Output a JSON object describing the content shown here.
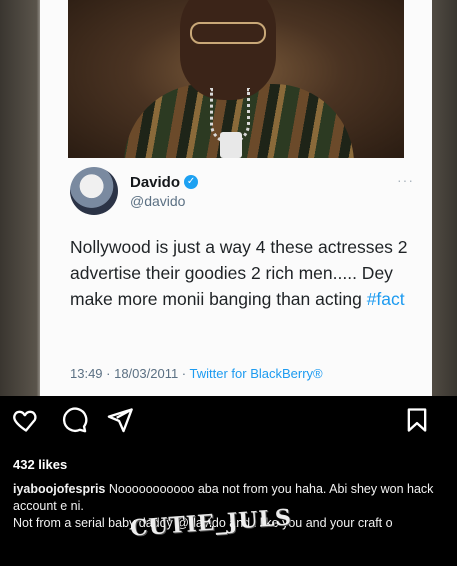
{
  "tweet": {
    "display_name": "Davido",
    "handle": "@davido",
    "text_main": "Nollywood is just a way 4 these actresses 2 advertise their goodies 2 rich men..... Dey make more monii banging than acting ",
    "hashtag": "#fact",
    "time": "13:49 · 18/03/2011 · ",
    "source": "Twitter for BlackBerry®",
    "more": "···"
  },
  "post": {
    "likes": "432 likes",
    "caption_user": "iyaboojofespris",
    "caption_line1": " Nooooooooooo aba not from you haha. Abi shey won hack account e ni.",
    "caption_line2": "Not from a serial baby daddy @davido and i like you and your craft o"
  },
  "watermark": "CUTIE_JULS",
  "icons": {
    "like": "heart-icon",
    "comment": "comment-icon",
    "share": "send-icon",
    "save": "bookmark-icon",
    "verified": "verified-badge-icon"
  },
  "colors": {
    "link": "#1d9bf0",
    "verified": "#1da1f2",
    "background": "#000000"
  }
}
